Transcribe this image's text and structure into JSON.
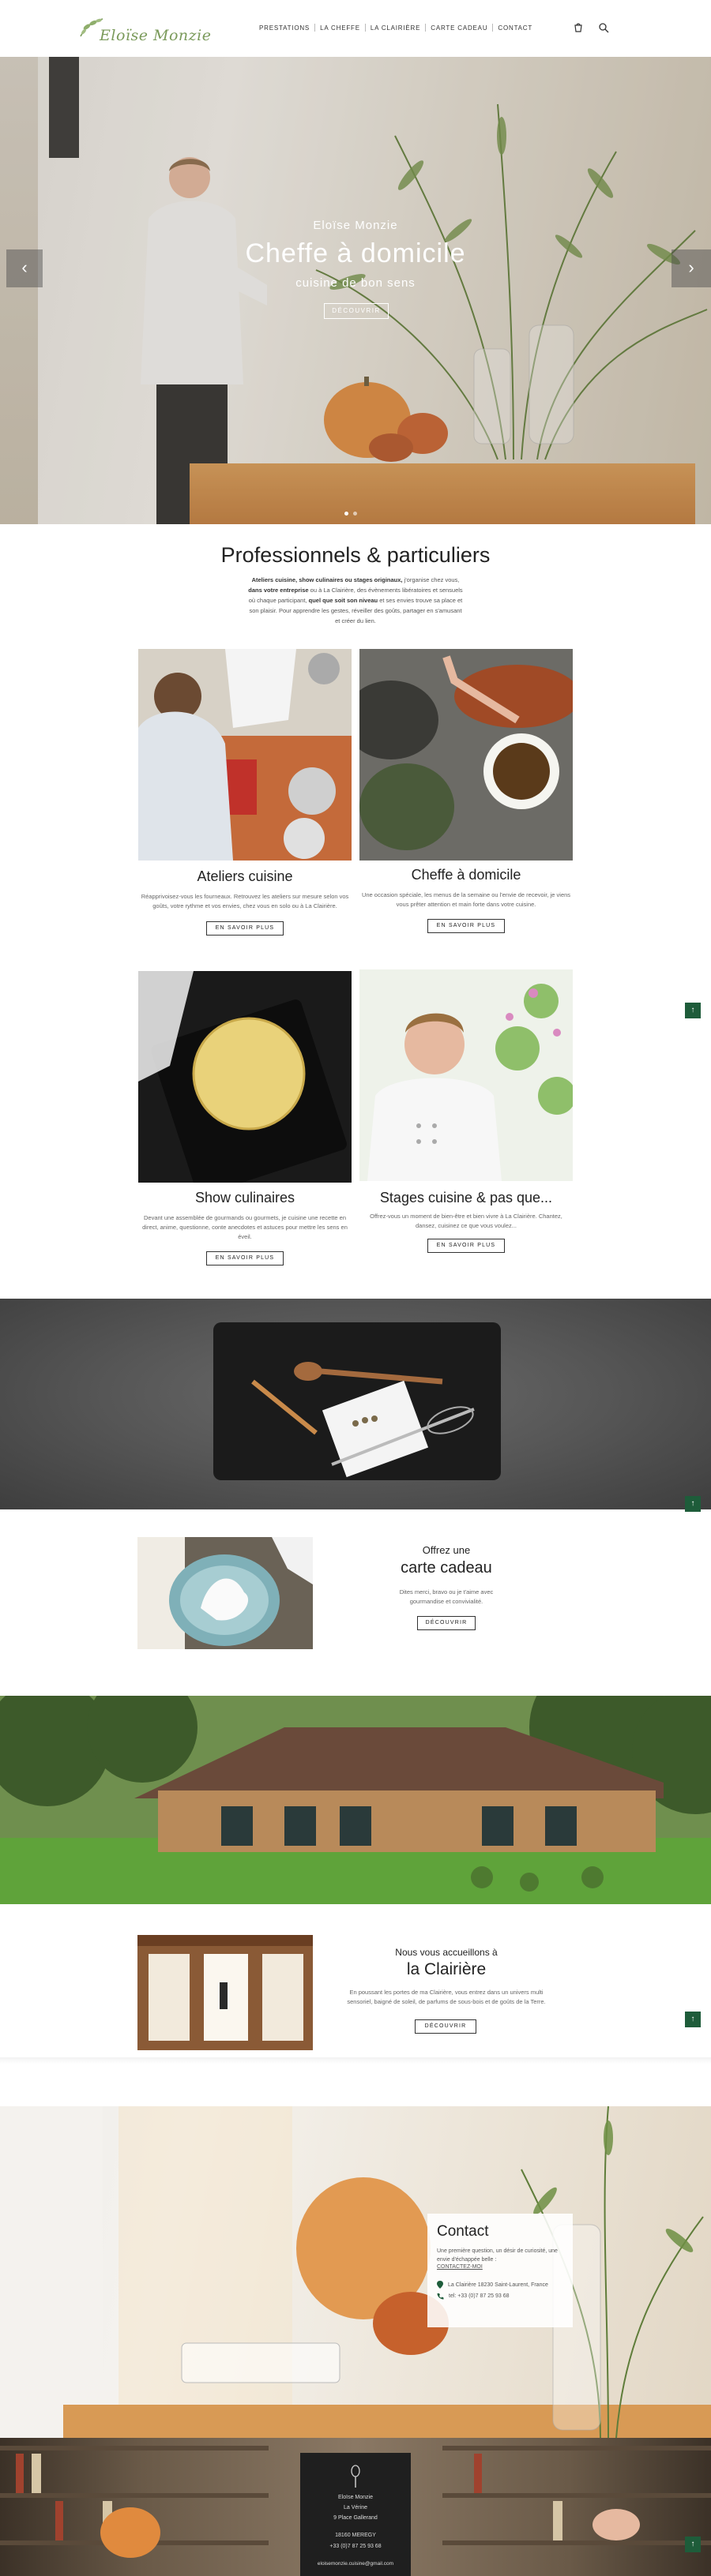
{
  "header": {
    "logo_text": "Eloïse Monzie",
    "nav": [
      "PRESTATIONS",
      "LA CHEFFE",
      "LA CLAIRIÈRE",
      "CARTE CADEAU",
      "CONTACT"
    ]
  },
  "hero": {
    "subtitle": "Eloïse Monzie",
    "title": "Cheffe à domicile",
    "tagline": "cuisine de bon sens",
    "button": "DÉCOUVRIR",
    "prev": "‹",
    "next": "›"
  },
  "intro": {
    "title": "Professionnels & particuliers",
    "text_bold1": "Ateliers cuisine, show culinaires ou stages originaux,",
    "text1": " j'organise chez vous, ",
    "text_bold2": "dans votre entreprise",
    "text2": " ou à La Clairière, des évènements libératoires et sensuels où chaque participant, ",
    "text_bold3": "quel que soit son niveau",
    "text3": " et ses envies trouve sa place et son plaisir. Pour apprendre les gestes, réveiller des goûts, partager en s'amusant et créer du lien."
  },
  "cards": [
    {
      "title": "Ateliers cuisine",
      "text": "Réapprivoisez-vous les fourneaux. Retrouvez les ateliers sur mesure selon vos goûts, votre rythme et vos envies, chez vous en solo ou à La Clairière.",
      "button": "EN SAVOIR PLUS"
    },
    {
      "title": "Cheffe à domicile",
      "text": "Une occasion spéciale, les menus de la semaine ou l'envie de recevoir, je viens vous prêter attention et main forte dans votre cuisine.",
      "button": "EN SAVOIR PLUS"
    },
    {
      "title": "Show culinaires",
      "text": "Devant une assemblée de gourmands ou gourmets, je cuisine une recette en direct, anime, questionne, conte anecdotes et astuces pour mettre les sens en éveil.",
      "button": "EN SAVOIR PLUS"
    },
    {
      "title": "Stages cuisine & pas que...",
      "text": "Offrez-vous un moment de bien-être et bien vivre à La Clairière. Chantez, dansez, cuisinez ce que vous voulez...",
      "button": "EN SAVOIR PLUS"
    }
  ],
  "gift": {
    "title1": "Offrez une",
    "title2": "carte cadeau",
    "text": "Dites merci, bravo ou je t'aime avec gourmandise et convivialité.",
    "button": "DÉCOUVRIR"
  },
  "clairiere": {
    "title1": "Nous vous accueillons à",
    "title2": "la Clairière",
    "text": "En poussant les portes de ma Clairière, vous entrez dans un univers multi sensoriel, baigné de soleil, de parfums de sous-bois et de goûts de la Terre.",
    "button": "DÉCOUVRIR"
  },
  "contact": {
    "title": "Contact",
    "text": "Une première question, un désir de curiosité, une envie d'échappée belle :",
    "link": "CONTACTEZ-MOI",
    "address": "La Clairière 18230 Saint-Laurent, France",
    "phone": "tel: +33 (0)7 87 25 93 68"
  },
  "footer": {
    "name": "Eloïse Monzie",
    "line1": "La Vérine",
    "line2": "9 Place Gallerand",
    "line3": "18160 MEREGY",
    "line4": "+33 (0)7 87 25 93 68",
    "email": "eloisemonzie.cuisine@gmail.com"
  },
  "to_top": "↑",
  "colors": {
    "accent": "#1e5c3a",
    "logo": "#7a9a5a"
  }
}
